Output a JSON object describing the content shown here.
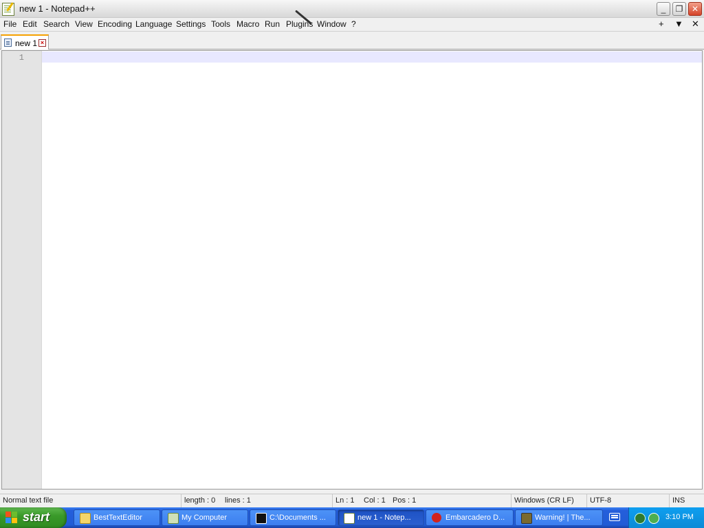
{
  "window": {
    "title": "new 1 - Notepad++",
    "minimize": "_",
    "restore": "❐",
    "close": "✕"
  },
  "menu": {
    "items": [
      "File",
      "Edit",
      "Search",
      "View",
      "Encoding",
      "Language",
      "Settings",
      "Tools",
      "Macro",
      "Run",
      "Plugins",
      "Window",
      "?"
    ],
    "right": [
      "+",
      "▼",
      "✕"
    ]
  },
  "tabs": [
    {
      "label": "new 1",
      "active": true
    }
  ],
  "editor": {
    "line_numbers": [
      "1"
    ],
    "content": ""
  },
  "statusbar": {
    "file_type": "Normal text file",
    "length": "length : 0",
    "lines": "lines : 1",
    "ln": "Ln : 1",
    "col": "Col : 1",
    "pos": "Pos : 1",
    "eol": "Windows (CR LF)",
    "encoding": "UTF-8",
    "mode": "INS"
  },
  "taskbar": {
    "start": "start",
    "items": [
      {
        "label": "BestTextEditor",
        "icon": "folder-icon",
        "active": false
      },
      {
        "label": "My Computer",
        "icon": "my-computer-icon",
        "active": false
      },
      {
        "label": "C:\\Documents ...",
        "icon": "7zip-icon",
        "active": false
      },
      {
        "label": "new 1 - Notep...",
        "icon": "notepad-plus-plus-icon",
        "active": true
      },
      {
        "label": "Embarcadero D...",
        "icon": "embarcadero-icon",
        "active": false
      },
      {
        "label": "Warning! | The...",
        "icon": "browser-icon",
        "active": false
      }
    ],
    "clock": "3:10 PM"
  },
  "colors": {
    "taskbar_blue": "#245edb",
    "start_green": "#3a9a2a",
    "active_tab_accent": "#f5a000",
    "current_line": "#e8e8ff"
  }
}
